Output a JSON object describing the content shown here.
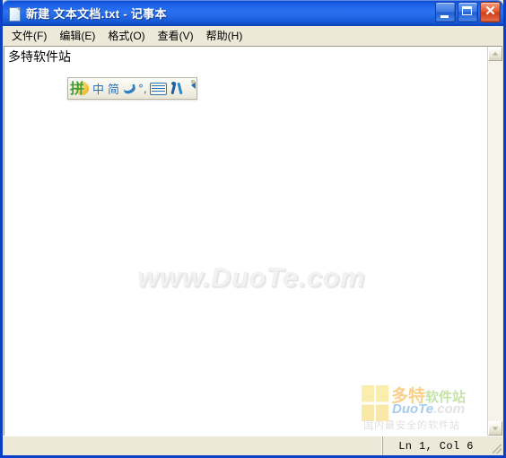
{
  "window": {
    "title": "新建 文本文档.txt - 记事本",
    "icon": "notepad-document-icon"
  },
  "window_buttons": {
    "minimize_label": "_",
    "maximize_label": "□",
    "close_label": "✕"
  },
  "menubar": {
    "items": [
      {
        "label": "文件(F)",
        "name": "menu-file"
      },
      {
        "label": "编辑(E)",
        "name": "menu-edit"
      },
      {
        "label": "格式(O)",
        "name": "menu-format"
      },
      {
        "label": "查看(V)",
        "name": "menu-view"
      },
      {
        "label": "帮助(H)",
        "name": "menu-help"
      }
    ]
  },
  "editor": {
    "content": "多特软件站",
    "watermark": "www.DuoTe.com"
  },
  "ime_bar": {
    "logo_char": "拼",
    "mode_language": "中",
    "mode_script": "简",
    "shape_icon": "half-moon-icon",
    "punctuation": "°,",
    "keyboard_icon": "soft-keyboard-icon",
    "tools_icon": "wrench-tools-icon",
    "expand_icon": "collapse-arrow-icon"
  },
  "logo_watermark": {
    "cn_primary": "多特",
    "cn_secondary": "软件站",
    "en_primary": "DuoTe",
    "en_secondary": ".com",
    "tagline": "国内最安全的软件站"
  },
  "scrollbar": {
    "up_icon": "scroll-up-arrow-icon",
    "down_icon": "scroll-down-arrow-icon"
  },
  "statusbar": {
    "left_text": "",
    "position": "Ln 1, Col 6"
  },
  "colors": {
    "titlebar_blue": "#1e63e8",
    "window_border": "#0b3fc4",
    "chrome_beige": "#ece9d8",
    "ime_blue": "#2a72b8",
    "close_red": "#e45b33"
  }
}
